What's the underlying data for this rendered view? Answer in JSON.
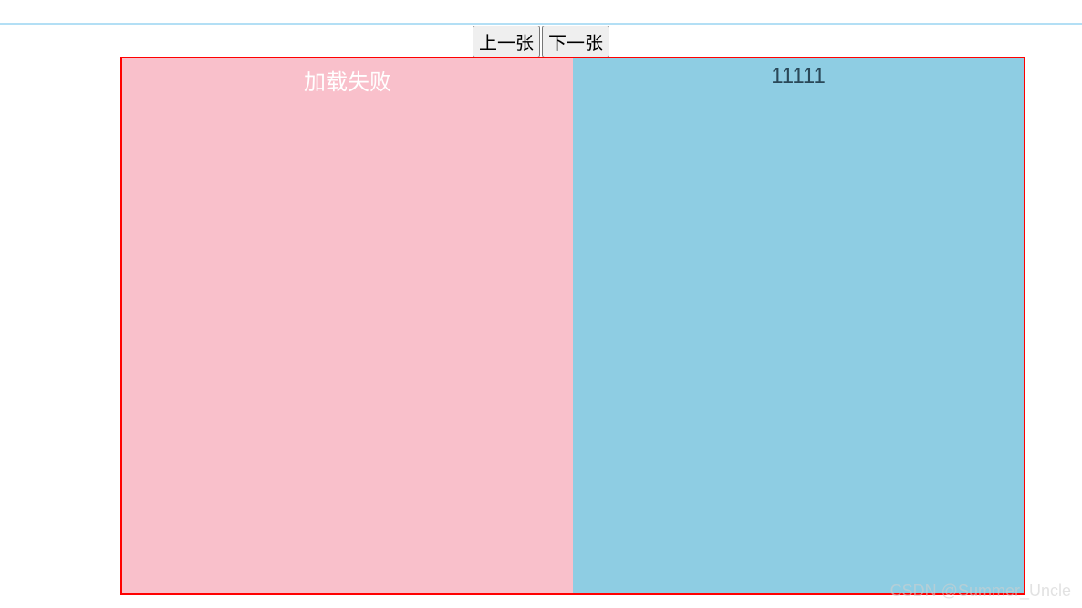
{
  "buttons": {
    "prev_label": "上一张",
    "next_label": "下一张"
  },
  "panels": {
    "left_text": "加载失败",
    "right_text": "11111"
  },
  "watermark": "CSDN @Summer_Uncle",
  "colors": {
    "border": "#ff0000",
    "left_panel_bg": "#f9c0cb",
    "right_panel_bg": "#8ecde3",
    "top_line": "#b3dff5"
  }
}
